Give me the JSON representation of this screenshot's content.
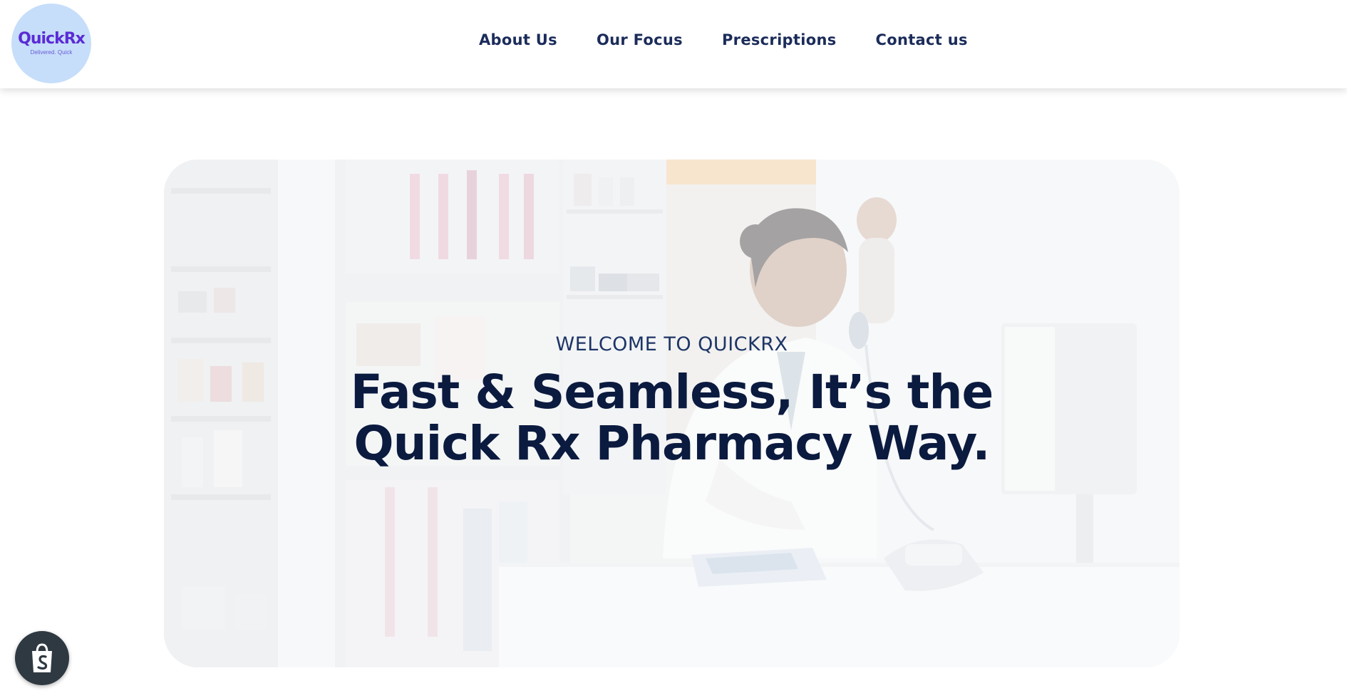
{
  "header": {
    "logo": {
      "name": "QuickRx",
      "tagline": "Delivered. Quick"
    },
    "nav": [
      "About Us",
      "Our Focus",
      "Prescriptions",
      "Contact us"
    ]
  },
  "hero": {
    "eyebrow": "WELCOME TO QUICKRX",
    "headline_line1": "Fast & Seamless, It’s the",
    "headline_line2": "Quick Rx Pharmacy Way.",
    "image": "pharmacist-on-phone-at-computer-photo"
  },
  "floating": {
    "icon": "shopify-bag-icon"
  },
  "colors": {
    "nav_text": "#1b2c5a",
    "headline": "#0b1a3f",
    "logo_bg": "#c6defa",
    "logo_text": "#5b2bd6"
  }
}
